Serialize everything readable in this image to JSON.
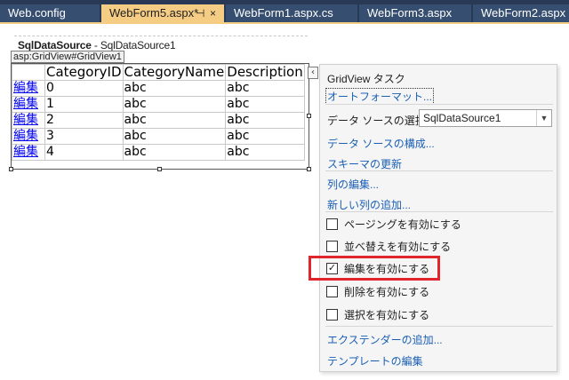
{
  "tabs": [
    {
      "label": "Web.config",
      "active": false
    },
    {
      "label": "WebForm5.aspx*",
      "active": true,
      "pin": "⊣",
      "close": "×"
    },
    {
      "label": "WebForm1.aspx.cs",
      "active": false
    },
    {
      "label": "WebForm3.aspx",
      "active": false
    },
    {
      "label": "WebForm2.aspx",
      "active": false
    }
  ],
  "designer": {
    "datasource_label": {
      "bold": "SqlDataSource",
      "rest": " - SqlDataSource1"
    },
    "control_tag": "asp:GridView#GridView1",
    "grid": {
      "headers": [
        "",
        "CategoryID",
        "CategoryName",
        "Description"
      ],
      "rows": [
        {
          "edit": "編集",
          "id": "0",
          "name": "abc",
          "desc": "abc"
        },
        {
          "edit": "編集",
          "id": "1",
          "name": "abc",
          "desc": "abc"
        },
        {
          "edit": "編集",
          "id": "2",
          "name": "abc",
          "desc": "abc"
        },
        {
          "edit": "編集",
          "id": "3",
          "name": "abc",
          "desc": "abc"
        },
        {
          "edit": "編集",
          "id": "4",
          "name": "abc",
          "desc": "abc"
        }
      ]
    },
    "smarttag_glyph": "‹"
  },
  "task_panel": {
    "title": "GridView タスク",
    "autoformat": "オートフォーマット...",
    "datasource_label": "データ ソースの選択:",
    "datasource_value": "SqlDataSource1",
    "configure_ds": "データ ソースの構成...",
    "refresh_schema": "スキーマの更新",
    "edit_columns": "列の編集...",
    "add_column": "新しい列の追加...",
    "checks": [
      {
        "label": "ページングを有効にする",
        "checked": false
      },
      {
        "label": "並べ替えを有効にする",
        "checked": false
      },
      {
        "label": "編集を有効にする",
        "checked": true
      },
      {
        "label": "削除を有効にする",
        "checked": false
      },
      {
        "label": "選択を有効にする",
        "checked": false
      }
    ],
    "add_extender": "エクステンダーの追加...",
    "edit_templates": "テンプレートの編集"
  },
  "colors": {
    "tab_bar": "#293955",
    "active_tab": "#f5cc84",
    "link": "#1a5fb4",
    "highlight": "#e0262c"
  }
}
